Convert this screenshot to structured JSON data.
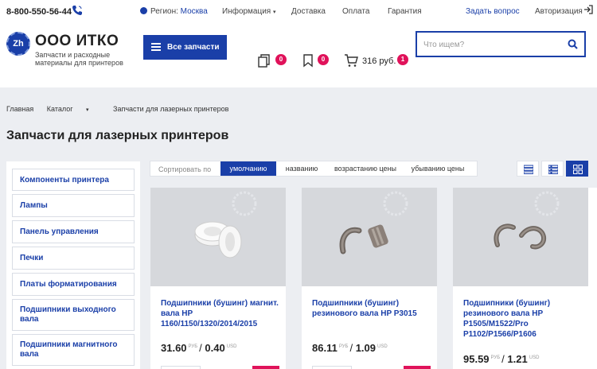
{
  "topbar": {
    "phone": "8-800-550-56-44",
    "region_label": "Регион:",
    "region_city": "Москва",
    "nav": [
      "Информация",
      "Доставка",
      "Оплата",
      "Гарантия"
    ],
    "ask_question": "Задать вопрос",
    "login": "Авторизация"
  },
  "header": {
    "logo_mark": "Zh",
    "company_name": "ООО ИТКО",
    "company_tagline": "Запчасти и расходные материалы для принтеров",
    "catalog_button": "Все запчасти",
    "compare_count": "0",
    "favorites_count": "0",
    "cart_sum": "316 руб.",
    "cart_count": "1",
    "search_placeholder": "Что ищем?"
  },
  "breadcrumb": [
    "Главная",
    "Каталог",
    "Запчасти для лазерных принтеров"
  ],
  "page_title": "Запчасти для лазерных принтеров",
  "sidebar": {
    "items": [
      "Компоненты принтера",
      "Лампы",
      "Панель управления",
      "Печки",
      "Платы форматирования",
      "Подшипники выходного вала",
      "Подшипники магнитного вала"
    ]
  },
  "sort": {
    "label": "Сортировать по",
    "options": [
      "умолчанию",
      "названию",
      "возрастанию цены",
      "убыванию цены"
    ],
    "active": "умолчанию"
  },
  "colors": {
    "accent": "#1a3fa8",
    "badge": "#e0125a",
    "background": "#eceef2"
  },
  "products": [
    {
      "name": "Подшипники (бушинг) магнит. вала HP 1160/1150/1320/2014/2015",
      "price_rub": "31.60",
      "price_usd": "0.40",
      "cur_rub": "РУБ",
      "cur_usd": "USD"
    },
    {
      "name": "Подшипники (бушинг) резинового вала HP P3015",
      "price_rub": "86.11",
      "price_usd": "1.09",
      "cur_rub": "РУБ",
      "cur_usd": "USD"
    },
    {
      "name": "Подшипники (бушинг) резинового вала HP P1505/M1522/Pro P1102/P1566/P1606",
      "price_rub": "95.59",
      "price_usd": "1.21",
      "cur_rub": "РУБ",
      "cur_usd": "USD"
    }
  ]
}
